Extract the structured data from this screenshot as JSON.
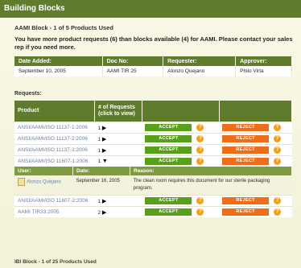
{
  "title": "Building Blocks",
  "block_header": "AAMI Block - 1 of 5 Products Used",
  "warning": "You have more product requests (6) than blocks available (4) for AAMI. Please contact your sales rep if you need more.",
  "info_table": {
    "headers": [
      "Date Added:",
      "Doc No:",
      "Requester:",
      "Approver:"
    ],
    "row": [
      "September 10, 2005",
      "AAMI TIR 25",
      "Alonzo Quejano",
      "Philo Virta"
    ]
  },
  "requests_label": "Requests:",
  "requests_table": {
    "headers": [
      "Product",
      "# of Requests (click to view)",
      "",
      ""
    ],
    "rows": [
      {
        "product": "ANSI/AAMI/ISO 11137-1:2006",
        "count": "1"
      },
      {
        "product": "ANSI/AAMI/ISO 11137-2:2006",
        "count": "1"
      },
      {
        "product": "ANSI/AAMI/ISO 11137-3:2006",
        "count": "1"
      },
      {
        "product": "ANSI/AAMI/ISO 11607-1:2006",
        "count": "1"
      },
      {
        "product": "ANSI/AAMI/ISO 11607-2:2006",
        "count": "1"
      },
      {
        "product": "AAMI TIR33:2005",
        "count": "2"
      }
    ],
    "accept_label": "ACCEPT",
    "reject_label": "REJECT",
    "info_glyph": "?"
  },
  "detail": {
    "headers": [
      "User:",
      "Date:",
      "Reason:"
    ],
    "user": "Alonzo Quejano",
    "date": "September 16, 2005",
    "reason": "The clean room requires this document for our sterile packaging program."
  },
  "bottom_header": "IBI Block - 1 of 25 Products Used",
  "colors": {
    "header_green": "#5f7c2c",
    "accept": "#58a018",
    "reject": "#ef6c19",
    "info": "#f1a01f"
  },
  "icons": {
    "arrow_collapsed": "play-arrow-icon",
    "arrow_expanded": "expanded-arrow-icon",
    "info": "info-icon",
    "document": "document-icon"
  }
}
